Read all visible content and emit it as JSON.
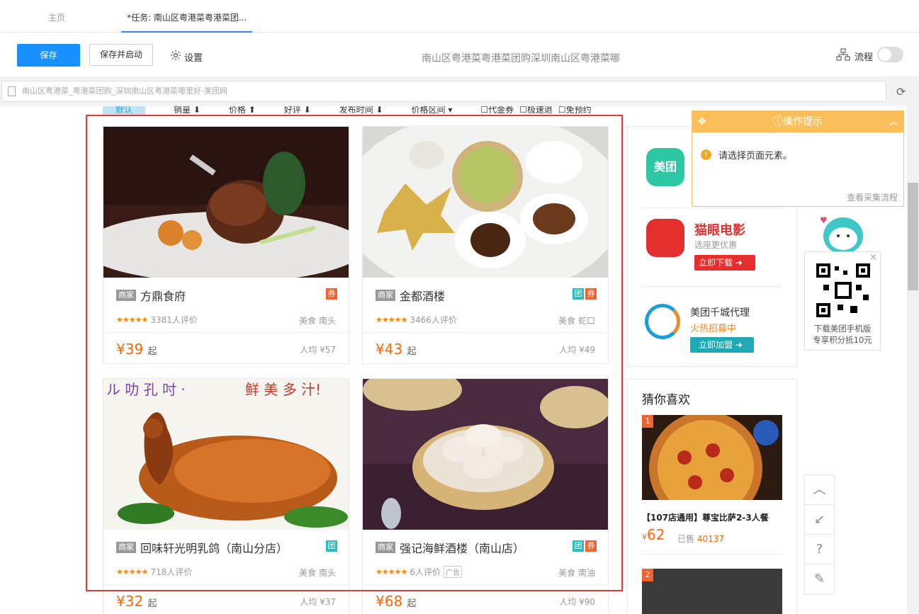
{
  "tabs": [
    {
      "label": "主页"
    },
    {
      "label": "*任务: 南山区粤港菜粤港菜团..."
    }
  ],
  "toolbar": {
    "save_label": "保存",
    "save_start_label": "保存并启动",
    "settings_label": "设置",
    "task_title": "南山区粤港菜粤港菜团购深圳南山区粤港菜哪",
    "flow_label": "流程"
  },
  "urlbar": {
    "value": "南山区粤港菜_粤港菜团购_深圳南山区粤港菜哪里好-美团网"
  },
  "sortbar": {
    "items": [
      "默认",
      "销量 ⬇",
      "价格 ⬆",
      "好评 ⬇",
      "发布时间 ⬇",
      "价格区间 ▾",
      "☐代金券",
      "☐极速退",
      "☐免预约"
    ]
  },
  "cards": [
    {
      "name": "方鼎食府",
      "reviews": "3381人评价",
      "area": "美食 南头",
      "price": "¥39",
      "price_suffix": "起",
      "avg": "人均 ¥57",
      "tuan": "",
      "quan": "券"
    },
    {
      "name": "金都酒楼",
      "reviews": "3466人评价",
      "area": "美食 蛇口",
      "price": "¥43",
      "price_suffix": "起",
      "avg": "人均 ¥49",
      "tuan": "团",
      "quan": "券"
    },
    {
      "name": "回味轩光明乳鸽（南山分店）",
      "reviews": "718人评价",
      "area": "美食 南头",
      "price": "¥32",
      "price_suffix": "起",
      "avg": "人均 ¥37",
      "tuan": "团",
      "quan": ""
    },
    {
      "name": "强记海鲜酒楼（南山店）",
      "reviews": "6人评价",
      "ad": "广告",
      "area": "美食 南油",
      "price": "¥68",
      "price_suffix": "起",
      "avg": "人均 ¥90",
      "tuan": "团",
      "quan": "券"
    }
  ],
  "shop_tag": "商家",
  "photo_banner": "鲜 美 多 汁!",
  "ads": {
    "meituan_logo": "美团",
    "maoyan_title": "猫眼电影",
    "maoyan_sub": "选座更优惠",
    "maoyan_btn": "立即下载",
    "agent_title": "美团千城代理",
    "agent_sub": "火热招募中",
    "agent_btn": "立即加盟"
  },
  "guess": {
    "title": "猜你喜欢",
    "items": [
      {
        "rank": "1",
        "title": "【107店通用】尊宝比萨2-3人餐",
        "price_symbol": "¥",
        "price": "62",
        "sold_label": "已售",
        "sold": "40137"
      },
      {
        "rank": "2"
      }
    ]
  },
  "tip": {
    "title": "操作提示",
    "message": "请选择页面元素。",
    "link": "查看采集流程"
  },
  "qr": {
    "line1": "下载美团手机版",
    "line2": "专享积分抵10元"
  },
  "colors": {
    "primary": "#1890ff",
    "price": "#ff6600",
    "selection": "#e53935",
    "tip": "#fbbf5a",
    "tuan": "#2bbcbc",
    "quan": "#f0622f"
  }
}
